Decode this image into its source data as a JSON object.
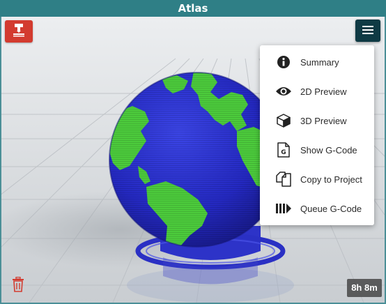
{
  "window": {
    "title": "Atlas"
  },
  "toolbar": {
    "slicer_icon": "slicer-nozzle-icon",
    "menu_icon": "hamburger-menu-icon"
  },
  "menu": {
    "items": [
      {
        "label": "Summary",
        "icon": "info-icon"
      },
      {
        "label": "2D Preview",
        "icon": "eye-icon"
      },
      {
        "label": "3D Preview",
        "icon": "cube-icon"
      },
      {
        "label": "Show G-Code",
        "icon": "gcode-file-icon"
      },
      {
        "label": "Copy to Project",
        "icon": "copy-icon"
      },
      {
        "label": "Queue G-Code",
        "icon": "queue-icon"
      }
    ]
  },
  "footer": {
    "print_time": "8h 8m",
    "delete_icon": "trash-icon"
  },
  "colors": {
    "titlebar": "#2f7f86",
    "slicer_button": "#d33b2f",
    "menu_button": "#0f3a44",
    "model_ocean": "#2b2fc9",
    "model_land": "#4ccb3c"
  }
}
